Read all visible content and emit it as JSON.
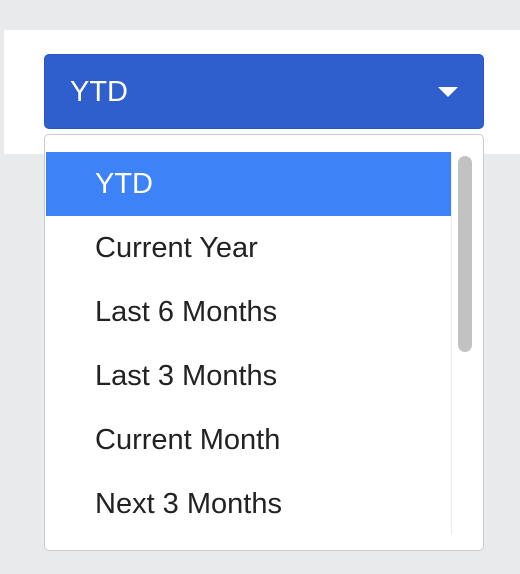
{
  "select": {
    "selected_value": "YTD",
    "icon": "caret-down-icon"
  },
  "dropdown": {
    "options": [
      "YTD",
      "Current Year",
      "Last 6 Months",
      "Last 3 Months",
      "Current Month",
      "Next 3 Months"
    ],
    "selected_index": 0
  },
  "colors": {
    "button": "#2f5fcc",
    "selected_option": "#3e82f7",
    "background": "#e9eaeb"
  }
}
